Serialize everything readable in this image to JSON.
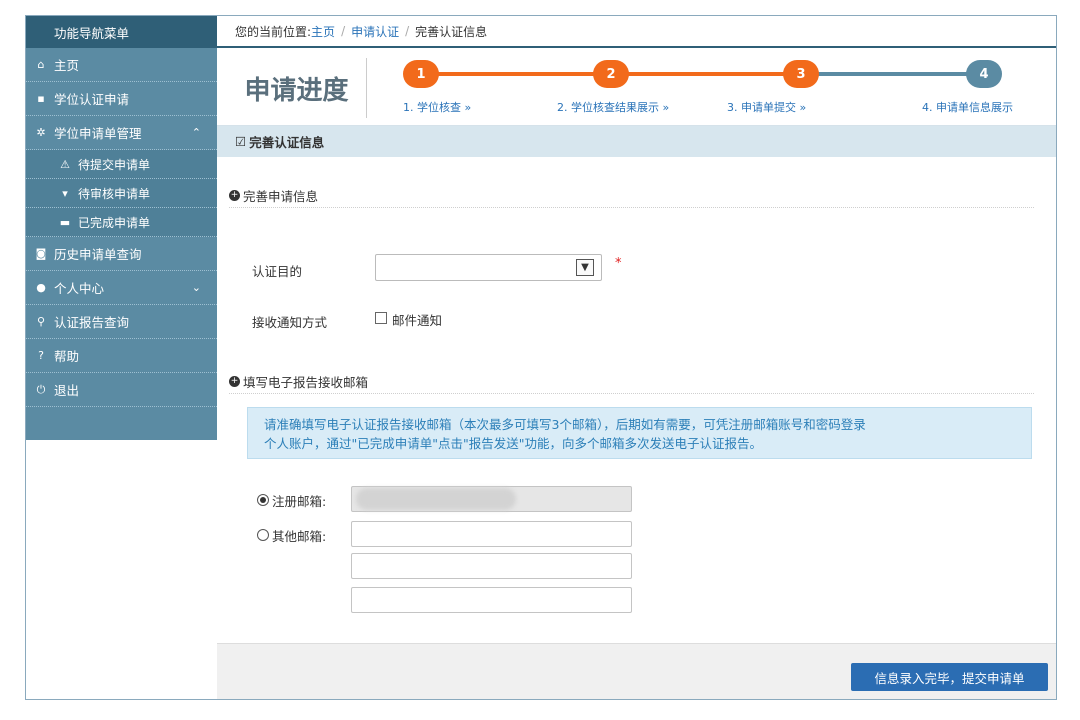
{
  "sidebar": {
    "title": "功能导航菜单",
    "items": [
      {
        "icon": "home-icon",
        "glyph": "⌂",
        "label": "主页"
      },
      {
        "icon": "document-icon",
        "glyph": "▪",
        "label": "学位认证申请"
      },
      {
        "icon": "gear-icon",
        "glyph": "✲",
        "label": "学位申请单管理",
        "chevron": "⌃"
      },
      {
        "icon": "warning-icon",
        "glyph": "⚠",
        "label": "待提交申请单"
      },
      {
        "icon": "cart-icon",
        "glyph": "▾",
        "label": "待审核申请单"
      },
      {
        "icon": "inbox-icon",
        "glyph": "▬",
        "label": "已完成申请单"
      },
      {
        "icon": "camera-icon",
        "glyph": "◙",
        "label": "历史申请单查询"
      },
      {
        "icon": "user-icon",
        "glyph": "●",
        "label": "个人中心",
        "chevron": "⌄"
      },
      {
        "icon": "search-icon",
        "glyph": "⚲",
        "label": "认证报告查询"
      },
      {
        "icon": "help-icon",
        "glyph": "?",
        "label": "帮助"
      },
      {
        "icon": "power-icon",
        "glyph": "⏻",
        "label": "退出"
      }
    ]
  },
  "breadcrumb": {
    "prefix": "您的当前位置:",
    "home": "主页",
    "sep": "/",
    "apply": "申请认证",
    "current": "完善认证信息"
  },
  "progress": {
    "title": "申请进度",
    "steps": [
      {
        "num": "1",
        "label": "1. 学位核查 »"
      },
      {
        "num": "2",
        "label": "2. 学位核查结果展示 »"
      },
      {
        "num": "3",
        "label": "3. 申请单提交 »"
      },
      {
        "num": "4",
        "label": "4. 申请单信息展示"
      }
    ],
    "active_color": "#f26a1b",
    "pending_color": "#5b8ba3"
  },
  "section": {
    "title": "完善认证信息",
    "icon": "edit-icon",
    "glyph": "☑"
  },
  "form": {
    "sub1": "完善申请信息",
    "purpose_label": "认证目的",
    "purpose_value": "",
    "required_mark": "*",
    "notify_label": "接收通知方式",
    "notify_option": "邮件通知",
    "notify_checked": false,
    "sub2": "填写电子报告接收邮箱",
    "notice_line1": "请准确填写电子认证报告接收邮箱（本次最多可填写3个邮箱），后期如有需要，可凭注册邮箱账号和密码登录",
    "notice_line2": "个人账户，通过\"已完成申请单\"点击\"报告发送\"功能，向多个邮箱多次发送电子认证报告。",
    "registered_label": "注册邮箱:",
    "other_label": "其他邮箱:",
    "selected_email": "registered"
  },
  "footer": {
    "submit_label": "信息录入完毕，提交申请单"
  }
}
